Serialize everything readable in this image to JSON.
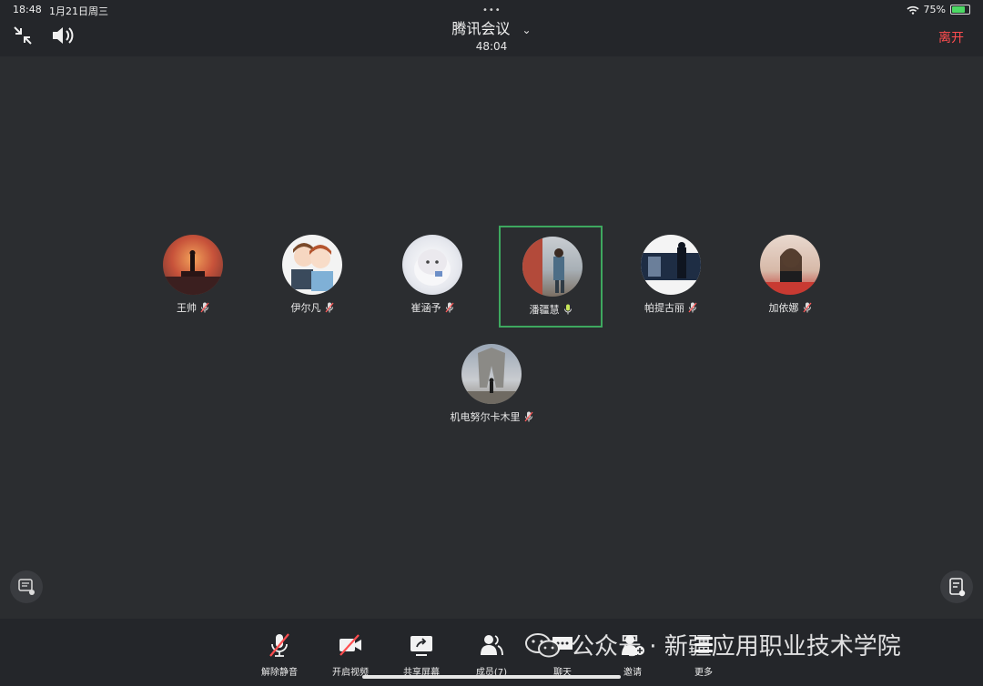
{
  "status_bar": {
    "time": "18:48",
    "date": "1月21日周三",
    "battery": "75%",
    "battery_level": 0.75
  },
  "header": {
    "title": "腾讯会议",
    "elapsed": "48:04",
    "leave_label": "离开"
  },
  "participants": [
    {
      "name": "王帅",
      "muted": true
    },
    {
      "name": "伊尔凡",
      "muted": true
    },
    {
      "name": "崔涵予",
      "muted": true
    },
    {
      "name": "潘疆慧",
      "muted": false,
      "active_speaker": true
    },
    {
      "name": "帕提古丽",
      "muted": true
    },
    {
      "name": "加依娜",
      "muted": true
    },
    {
      "name": "机电努尔卡木里",
      "muted": true
    }
  ],
  "toolbar": {
    "unmute": "解除静音",
    "start_video": "开启视频",
    "share_screen": "共享屏幕",
    "members": "成员(7)",
    "chat": "聊天",
    "invite": "邀请",
    "more": "更多"
  },
  "watermark": {
    "text": "公众号 · 新疆应用职业技术学院"
  },
  "colors": {
    "accent_green": "#3ea85f",
    "leave_red": "#ff4d4f",
    "background": "#2b2d30"
  }
}
